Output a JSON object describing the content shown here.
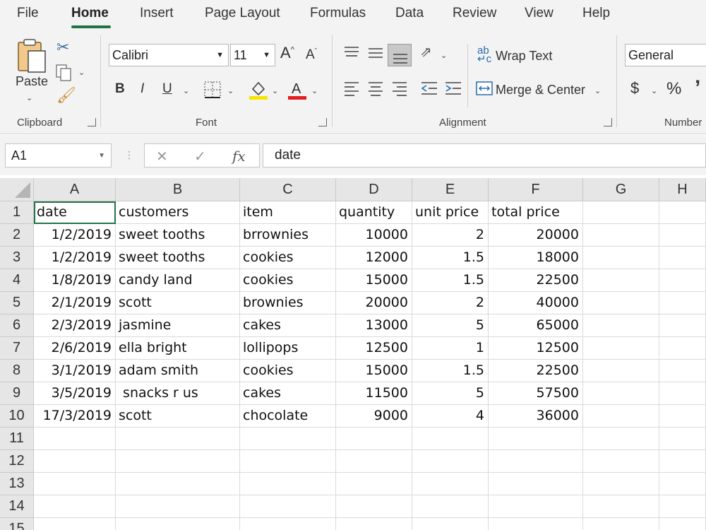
{
  "menu": {
    "tabs": [
      "File",
      "Home",
      "Insert",
      "Page Layout",
      "Formulas",
      "Data",
      "Review",
      "View",
      "Help"
    ],
    "active_tab": "Home"
  },
  "ribbon": {
    "clipboard": {
      "paste_label": "Paste",
      "group_label": "Clipboard"
    },
    "font": {
      "font_name": "Calibri",
      "font_size": "11",
      "group_label": "Font",
      "bold": "B",
      "italic": "I",
      "underline": "U"
    },
    "alignment": {
      "wrap_text": "Wrap Text",
      "merge_center": "Merge & Center",
      "group_label": "Alignment"
    },
    "number": {
      "format": "General",
      "currency": "$",
      "percent": "%",
      "group_label": "Number"
    }
  },
  "formula_bar": {
    "name_box": "A1",
    "fx": "fx",
    "content": "date"
  },
  "sheet": {
    "columns": [
      "A",
      "B",
      "C",
      "D",
      "E",
      "F",
      "G",
      "H"
    ],
    "rows": [
      "1",
      "2",
      "3",
      "4",
      "5",
      "6",
      "7",
      "8",
      "9",
      "10",
      "11",
      "12",
      "13",
      "14",
      "15"
    ],
    "headers": [
      "date",
      "customers",
      "item",
      "quantity",
      "unit price",
      "total price"
    ],
    "data": [
      [
        "1/2/2019",
        "sweet tooths",
        "brrownies",
        "10000",
        "2",
        "20000"
      ],
      [
        "1/2/2019",
        "sweet tooths",
        "cookies",
        "12000",
        "1.5",
        "18000"
      ],
      [
        "1/8/2019",
        "candy land",
        "cookies",
        "15000",
        "1.5",
        "22500"
      ],
      [
        "2/1/2019",
        "scott",
        "brownies",
        "20000",
        "2",
        "40000"
      ],
      [
        "2/3/2019",
        "jasmine",
        "cakes",
        "13000",
        "5",
        "65000"
      ],
      [
        "2/6/2019",
        "ella bright",
        "lollipops",
        "12500",
        "1",
        "12500"
      ],
      [
        "3/1/2019",
        "adam smith",
        "cookies",
        "15000",
        "1.5",
        "22500"
      ],
      [
        "3/5/2019",
        " snacks r us",
        "cakes",
        "11500",
        "5",
        "57500"
      ],
      [
        "17/3/2019",
        "scott",
        "chocolate",
        "9000",
        "4",
        "36000"
      ]
    ]
  }
}
